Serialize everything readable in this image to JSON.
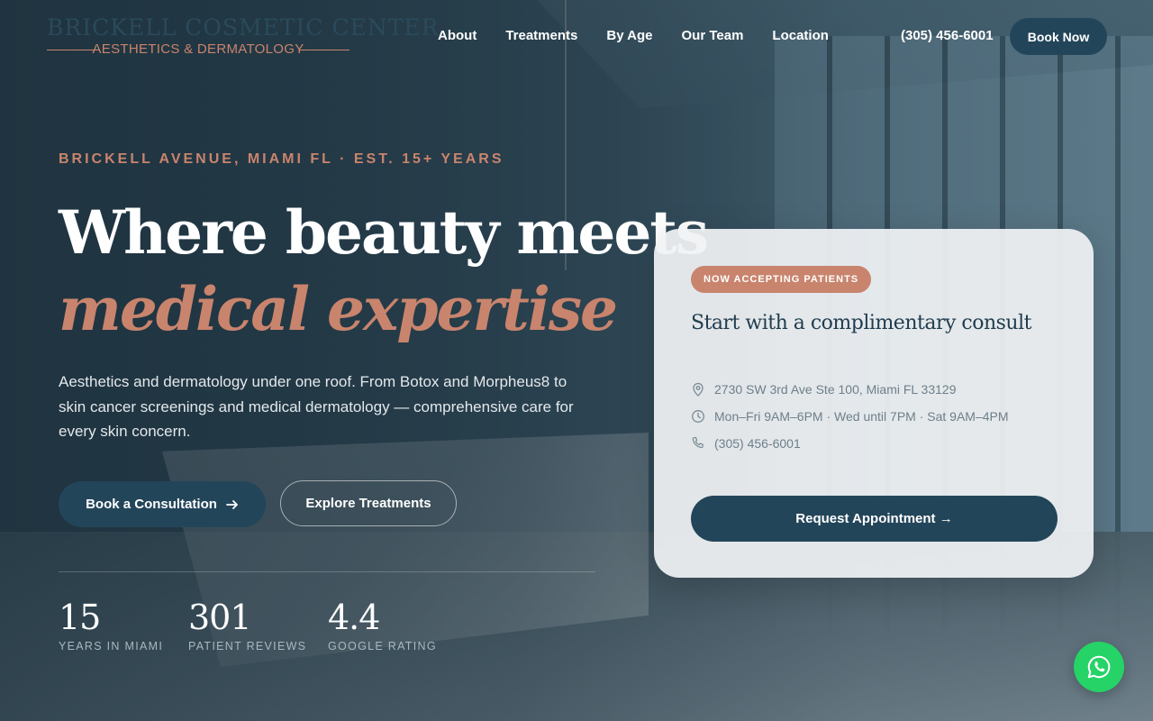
{
  "logo": {
    "name": "BRICKELL COSMETIC CENTER",
    "tagline": "AESTHETICS & DERMATOLOGY"
  },
  "nav": {
    "items": [
      {
        "label": "About"
      },
      {
        "label": "Treatments"
      },
      {
        "label": "By Age"
      },
      {
        "label": "Our Team"
      },
      {
        "label": "Location"
      }
    ],
    "phone": "(305) 456-6001",
    "book_label": "Book Now"
  },
  "hero": {
    "eyebrow": "BRICKELL AVENUE, MIAMI FL · EST. 15+ YEARS",
    "headline_line1": "Where beauty meets",
    "headline_line2": "medical expertise",
    "lead": "Aesthetics and dermatology under one roof. From Botox and Morpheus8 to skin cancer screenings and medical dermatology — comprehensive care for every skin concern.",
    "primary_cta": "Book a Consultation",
    "secondary_cta": "Explore Treatments",
    "stats": [
      {
        "value": "15",
        "label": "YEARS IN MIAMI"
      },
      {
        "value": "301",
        "label": "PATIENT REVIEWS"
      },
      {
        "value": "4.4",
        "label": "GOOGLE RATING"
      }
    ]
  },
  "card": {
    "badge": "NOW ACCEPTING PATIENTS",
    "title": "Start with a complimentary consult",
    "address": "2730 SW 3rd Ave Ste 100, Miami FL 33129",
    "hours": "Mon–Fri 9AM–6PM · Wed until 7PM · Sat 9AM–4PM",
    "phone": "(305) 456-6001",
    "cta": "Request Appointment →"
  },
  "icons": {
    "location": "map-pin-icon",
    "clock": "clock-icon",
    "phone": "phone-icon",
    "arrow": "arrow-right-icon",
    "whatsapp": "whatsapp-icon"
  },
  "colors": {
    "navy": "#23455a",
    "terracotta": "#c9846d",
    "whatsapp": "#25d366"
  }
}
